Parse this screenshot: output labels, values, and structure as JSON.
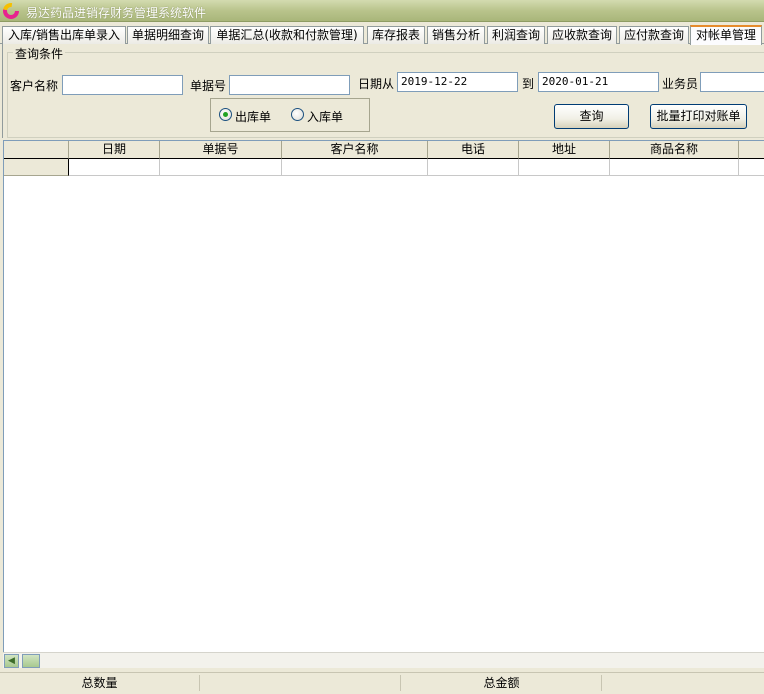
{
  "window": {
    "title": "易达药品进销存财务管理系统软件",
    "icon": "app-logo-icon"
  },
  "tabs": [
    {
      "label": "入库/销售出库单录入",
      "active": false
    },
    {
      "label": "单据明细查询",
      "active": false
    },
    {
      "label": "单据汇总(收款和付款管理)",
      "active": false
    },
    {
      "label": "库存报表",
      "active": false
    },
    {
      "label": "销售分析",
      "active": false
    },
    {
      "label": "利润查询",
      "active": false
    },
    {
      "label": "应收款查询",
      "active": false
    },
    {
      "label": "应付款查询",
      "active": false
    },
    {
      "label": "对帐单管理",
      "active": true
    }
  ],
  "query": {
    "group_title": "查询条件",
    "customer_label": "客户名称",
    "customer_value": "",
    "doc_no_label": "单据号",
    "doc_no_value": "",
    "date_from_label": "日期从",
    "date_from": "2019-12-22",
    "date_to_label": "到",
    "date_to": "2020-01-21",
    "salesman_label": "业务员",
    "salesman_value": "",
    "radio_out_label": "出库单",
    "radio_in_label": "入库单",
    "selected_radio": "out",
    "query_button": "查询",
    "print_button": "批量打印对账单"
  },
  "table": {
    "columns": [
      "日期",
      "单据号",
      "客户名称",
      "电话",
      "地址",
      "商品名称"
    ],
    "rows": []
  },
  "status": {
    "total_qty_label": "总数量",
    "total_qty_value": "",
    "total_amount_label": "总金额",
    "total_amount_value": ""
  }
}
